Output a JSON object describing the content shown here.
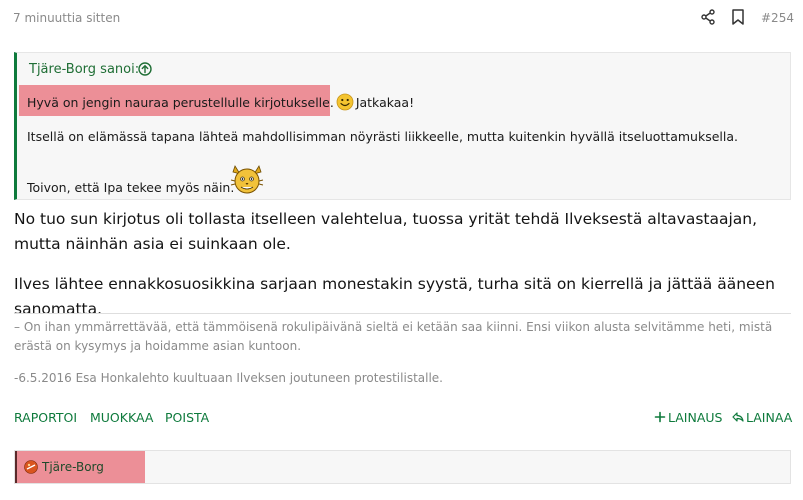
{
  "header": {
    "time": "7 minuuttia sitten",
    "post_number": "#254"
  },
  "quote": {
    "author": "Tjäre-Borg sanoi:",
    "line1_highlight": "Hyvä on jengin nauraa perustellulle kirjotukselle.",
    "line1_rest": "Jatkakaa!",
    "line2": "Itsellä on elämässä tapana lähteä mahdollisimman nöyrästi liikkeelle, mutta kuitenkin hyvällä itseluottamuksella.",
    "line3": "Toivon, että Ipa tekee myös näin."
  },
  "body": {
    "paragraph1": "No tuo sun kirjotus oli tollasta itselleen valehtelua, tuossa yrität tehdä Ilveksestä altavastaajan, mutta näinhän asia ei suinkaan ole.",
    "paragraph2": "Ilves lähtee ennakkosuosikkina sarjaan monestakin syystä, turha sitä on kierrellä ja jättää ääneen sanomatta."
  },
  "signature": {
    "line1": "– On ihan ymmärrettävää, että tämmöisenä rokulipäivänä sieltä ei ketään saa kiinni. Ensi viikon alusta selvitämme heti, mistä erästä on kysymys ja hoidamme asian kuntoon.",
    "line2": "-6.5.2016 Esa Honkalehto kuultuaan Ilveksen joutuneen protestilistalle."
  },
  "actions": {
    "report": "Raportoi",
    "edit": "Muokkaa",
    "delete": "Poista",
    "quote": "Lainaus",
    "reply": "Lainaa"
  },
  "next_post": {
    "author": "Tjäre-Borg"
  },
  "colors": {
    "accent": "#0e7a3c",
    "highlight": "#ec8f97"
  }
}
